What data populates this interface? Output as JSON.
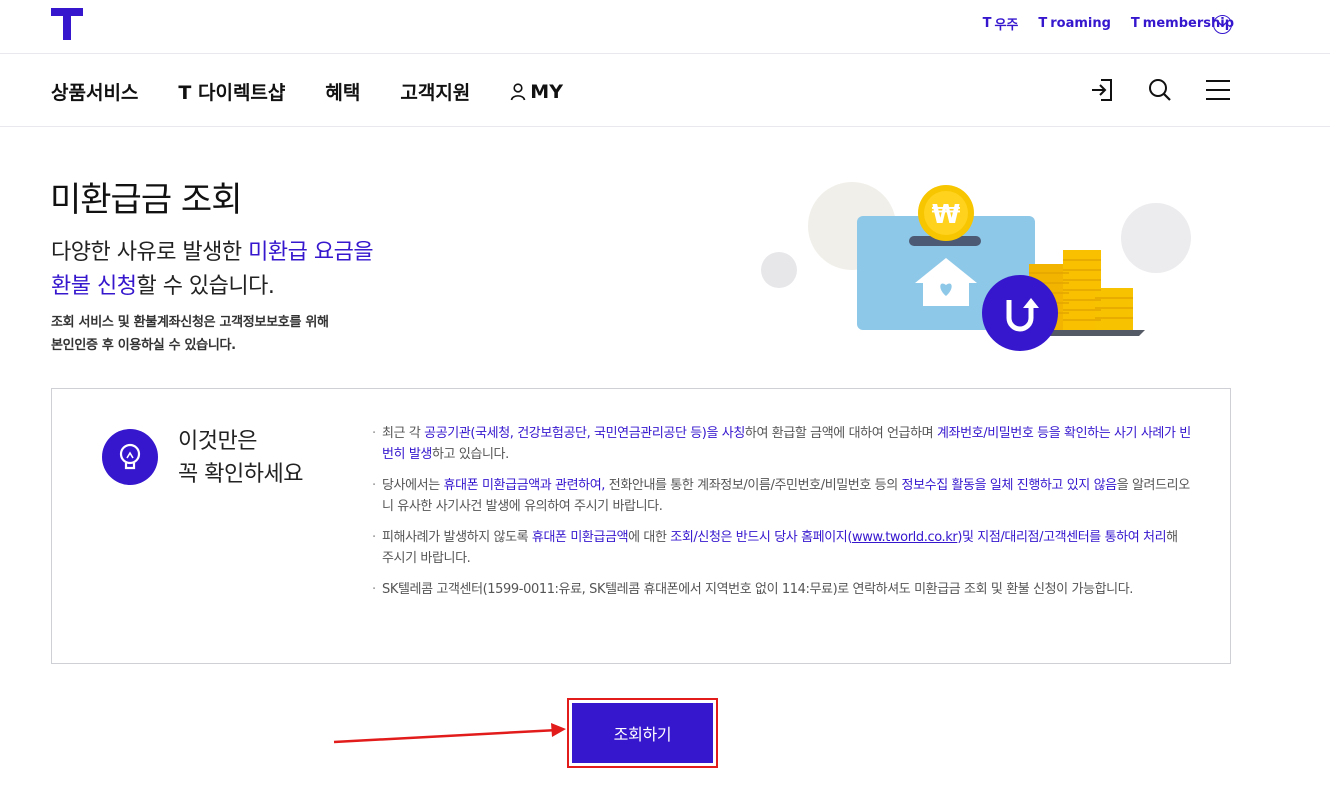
{
  "header": {
    "logo": "T",
    "links": [
      {
        "prefix": "T",
        "label": "우주"
      },
      {
        "prefix": "T",
        "label": "roaming"
      },
      {
        "prefix": "T",
        "label": "membership"
      }
    ],
    "more_icon": "chevron-down-icon"
  },
  "nav": {
    "items": [
      "상품서비스",
      "T 다이렉트샵",
      "혜택",
      "고객지원"
    ],
    "my_label": "MY",
    "icons": [
      "login-icon",
      "search-icon",
      "menu-icon"
    ]
  },
  "hero": {
    "title": "미환급금 조회",
    "subtitle_line1_plain": "다양한 사유로 발생한 ",
    "subtitle_line1_hl": "미환급 요금을",
    "subtitle_line2_hl": "환불 신청",
    "subtitle_line2_plain": "할 수 있습니다.",
    "note_line1": "조회 서비스 및 환불계좌신청은 고객정보보호를 위해",
    "note_line2": "본인인증 후 이용하실 수 있습니다.",
    "illustration": {
      "coin_symbol": "₩"
    }
  },
  "notice": {
    "title_line1": "이것만은",
    "title_line2": "꼭 확인하세요",
    "items": [
      {
        "p1": "최근 각 ",
        "h1": "공공기관(국세청, 건강보험공단, 국민연금관리공단 등)을 사칭",
        "p2": "하여 환급할 금액에 대하여 언급하며 ",
        "h2": "계좌번호/비밀번호 등을 확인하는 사기 사례가 빈번히 발생",
        "p3": "하고 있습니다."
      },
      {
        "p1": "당사에서는 ",
        "h1": "휴대폰 미환급금액과 관련하여,",
        "p2": " 전화안내를 통한 계좌정보/이름/주민번호/비밀번호 등의 ",
        "h2": "정보수집 활동을 일체 진행하고 있지 않음",
        "p3": "을 알려드리오니 유사한 사기사건 발생에 유의하여 주시기 바랍니다."
      },
      {
        "p1": "피해사례가 발생하지 않도록 ",
        "h1": "휴대폰 미환급금액",
        "p2": "에 대한 ",
        "h2a": "조회/신청은 반드시 당사 홈페이지(",
        "link": "www.tworld.co.kr",
        "h2b": ")및 지점/대리점/고객센터를 통하여 처리",
        "p3": "해 주시기 바랍니다."
      },
      {
        "p1": "SK텔레콤 고객센터(1599-0011:유료, SK텔레콤 휴대폰에서 지역번호 없이 114:무료)로 연락하셔도 미환급금 조회 및 환불 신청이 가능합니다."
      }
    ]
  },
  "action": {
    "label": "조회하기"
  },
  "colors": {
    "brand": "#3617CE",
    "highlight_border": "#e21b1b",
    "arrow": "#e21b1b"
  }
}
